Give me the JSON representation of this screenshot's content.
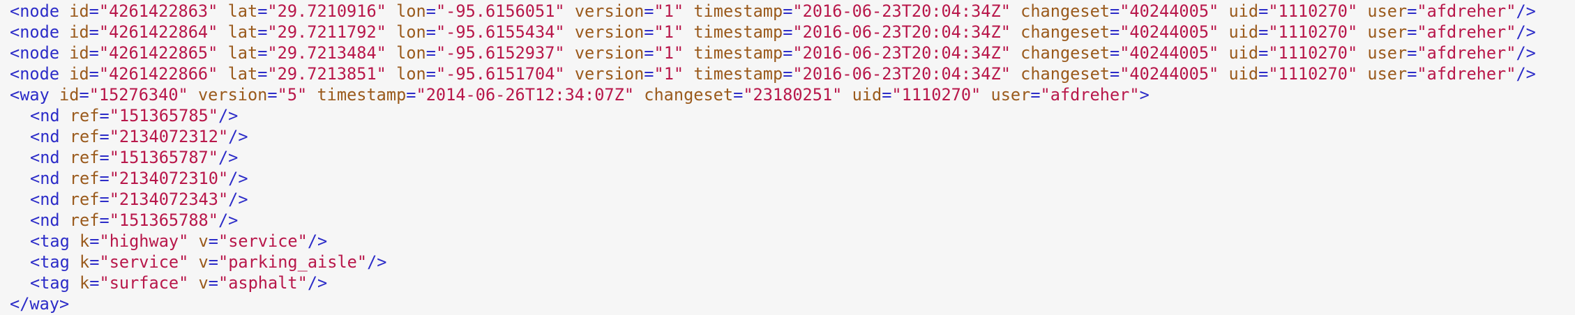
{
  "xml": {
    "nodes": [
      {
        "id": "4261422863",
        "lat": "29.7210916",
        "lon": "-95.6156051",
        "version": "1",
        "timestamp": "2016-06-23T20:04:34Z",
        "changeset": "40244005",
        "uid": "1110270",
        "user": "afdreher"
      },
      {
        "id": "4261422864",
        "lat": "29.7211792",
        "lon": "-95.6155434",
        "version": "1",
        "timestamp": "2016-06-23T20:04:34Z",
        "changeset": "40244005",
        "uid": "1110270",
        "user": "afdreher"
      },
      {
        "id": "4261422865",
        "lat": "29.7213484",
        "lon": "-95.6152937",
        "version": "1",
        "timestamp": "2016-06-23T20:04:34Z",
        "changeset": "40244005",
        "uid": "1110270",
        "user": "afdreher"
      },
      {
        "id": "4261422866",
        "lat": "29.7213851",
        "lon": "-95.6151704",
        "version": "1",
        "timestamp": "2016-06-23T20:04:34Z",
        "changeset": "40244005",
        "uid": "1110270",
        "user": "afdreher"
      }
    ],
    "way": {
      "id": "15276340",
      "version": "5",
      "timestamp": "2014-06-26T12:34:07Z",
      "changeset": "23180251",
      "uid": "1110270",
      "user": "afdreher",
      "nd_refs": [
        "151365785",
        "2134072312",
        "151365787",
        "2134072310",
        "2134072343",
        "151365788"
      ],
      "tags": [
        {
          "k": "highway",
          "v": "service"
        },
        {
          "k": "service",
          "v": "parking_aisle"
        },
        {
          "k": "surface",
          "v": "asphalt"
        }
      ]
    }
  },
  "colors": {
    "background": "#f6f6f6",
    "tag": "#2c2cc8",
    "attribute": "#9a5a1c",
    "value": "#b8174a"
  }
}
